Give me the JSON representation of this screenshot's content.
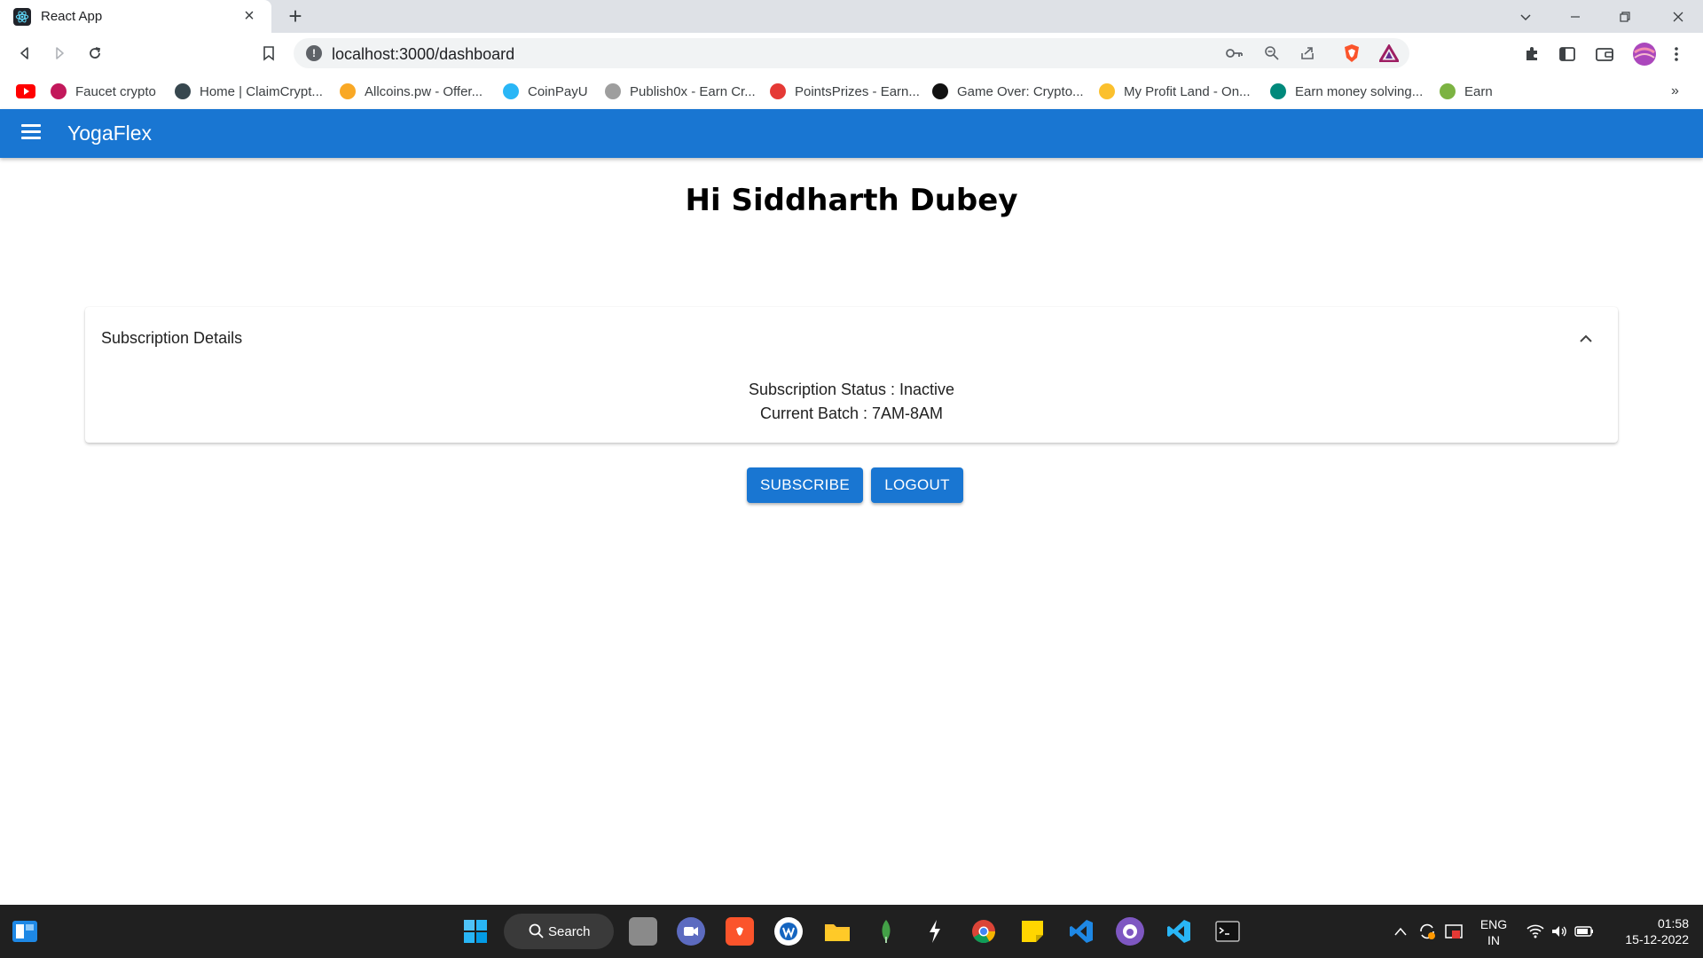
{
  "browser": {
    "tab_title": "React App",
    "url": "localhost:3000/dashboard",
    "bookmarks": [
      {
        "label": "Faucet crypto",
        "color": "#c2185b"
      },
      {
        "label": "Home | ClaimCrypt...",
        "color": "#37474f"
      },
      {
        "label": "Allcoins.pw - Offer...",
        "color": "#f9a825"
      },
      {
        "label": "CoinPayU",
        "color": "#29b6f6"
      },
      {
        "label": "Publish0x - Earn Cr...",
        "color": "#9e9e9e"
      },
      {
        "label": "PointsPrizes - Earn...",
        "color": "#e53935"
      },
      {
        "label": "Game Over: Crypto...",
        "color": "#111111"
      },
      {
        "label": "My Profit Land - On...",
        "color": "#fbc02d"
      },
      {
        "label": "Earn money solving...",
        "color": "#00897b"
      },
      {
        "label": "Earn",
        "color": "#7cb342"
      }
    ]
  },
  "app": {
    "brand": "YogaFlex",
    "greeting": "Hi Siddharth Dubey",
    "subscription": {
      "title": "Subscription Details",
      "status_line": "Subscription Status : Inactive",
      "batch_line": "Current Batch : 7AM-8AM"
    },
    "buttons": {
      "subscribe": "SUBSCRIBE",
      "logout": "LOGOUT"
    },
    "accent_color": "#1976d2"
  },
  "taskbar": {
    "search_label": "Search",
    "lang_top": "ENG",
    "lang_bottom": "IN",
    "time": "01:58",
    "date": "15-12-2022"
  }
}
